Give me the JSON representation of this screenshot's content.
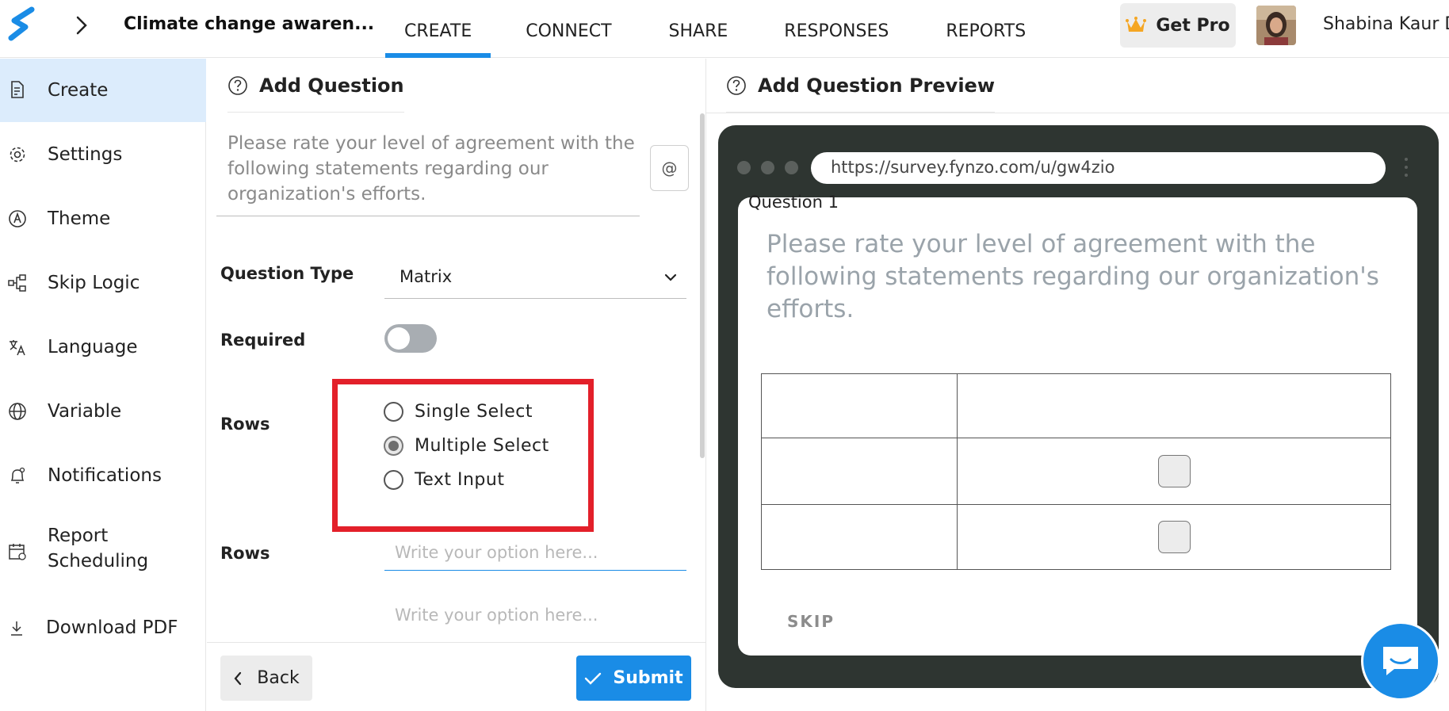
{
  "header": {
    "app_title": "Climate change awaren...",
    "tabs": [
      {
        "label": "CREATE",
        "active": true
      },
      {
        "label": "CONNECT",
        "active": false
      },
      {
        "label": "SHARE",
        "active": false
      },
      {
        "label": "RESPONSES",
        "active": false
      },
      {
        "label": "REPORTS",
        "active": false
      }
    ],
    "get_pro_label": "Get Pro",
    "user_name": "Shabina Kaur D",
    "icons": [
      "logo-icon",
      "chevron-right-icon",
      "crown-icon",
      "avatar"
    ]
  },
  "sidebar": {
    "items": [
      {
        "label": "Create",
        "icon": "create-file-icon",
        "active": true
      },
      {
        "label": "Settings",
        "icon": "gear-icon"
      },
      {
        "label": "Theme",
        "icon": "theme-icon"
      },
      {
        "label": "Skip Logic",
        "icon": "skip-logic-icon"
      },
      {
        "label": "Language",
        "icon": "translate-icon"
      },
      {
        "label": "Variable",
        "icon": "globe-icon"
      },
      {
        "label": "Notifications",
        "icon": "bell-icon"
      },
      {
        "label": "Report Scheduling",
        "icon": "calendar-icon"
      },
      {
        "label": "Download PDF",
        "icon": "download-icon"
      }
    ]
  },
  "editor": {
    "title": "Add Question",
    "question_text": "Please rate your level of agreement with the following statements regarding our organization's efforts.",
    "at_button": "@",
    "question_type_label": "Question Type",
    "question_type_value": "Matrix",
    "required_label": "Required",
    "required_on": false,
    "rows_label": "Rows",
    "row_type_options": [
      {
        "label": "Single Select",
        "checked": false
      },
      {
        "label": "Multiple Select",
        "checked": true
      },
      {
        "label": "Text Input",
        "checked": false
      }
    ],
    "rows_label_2": "Rows",
    "option_placeholder": "Write your option here...",
    "back_label": "Back",
    "submit_label": "Submit"
  },
  "preview": {
    "title": "Add Question Preview",
    "url": "https://survey.fynzo.com/u/gw4zio",
    "question_number": "Question 1",
    "question_text": "Please rate your level of agreement with the following statements regarding our organization's efforts.",
    "skip_label": "SKIP",
    "matrix_checkbox_rows": 2
  },
  "colors": {
    "accent": "#1a8ce6",
    "highlight": "#e3202a",
    "preview_frame": "#2e3531",
    "sidebar_active": "#dcecfc"
  }
}
